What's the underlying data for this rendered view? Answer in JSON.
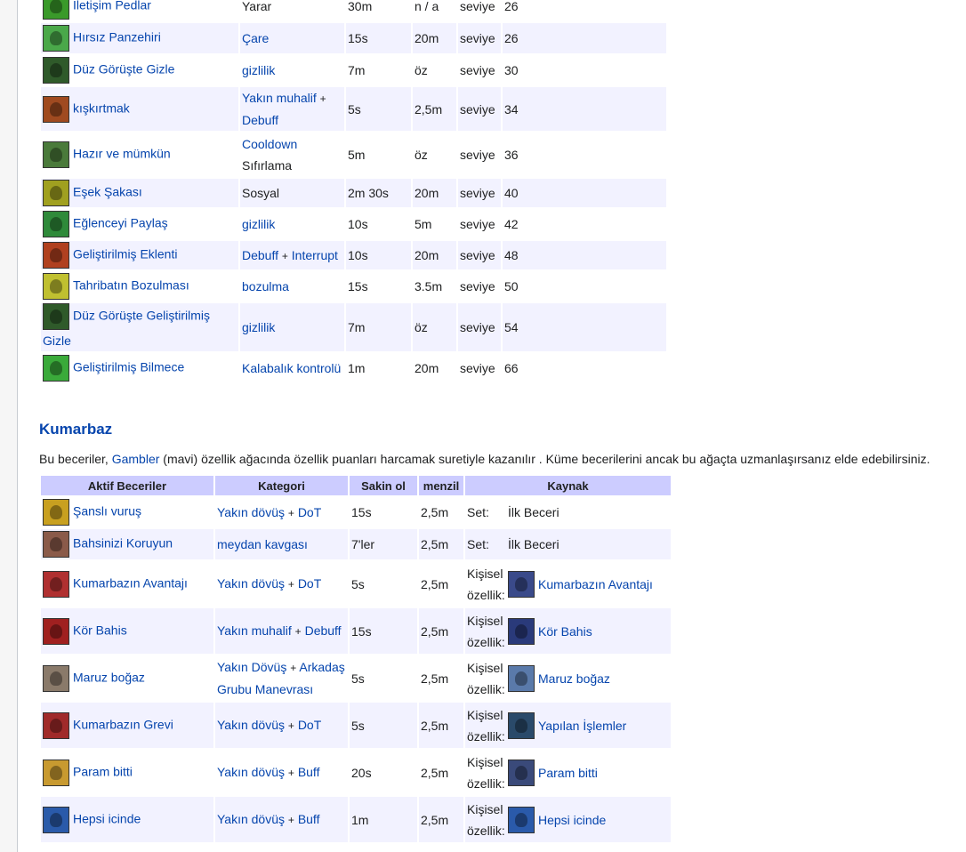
{
  "upper_table": {
    "rows": [
      {
        "icon": "green-hand-icon",
        "icon_color": "#3a9a2a",
        "name": "İletişim Pedlar",
        "cat1": "Yarar",
        "cat1_link": false,
        "plus": "",
        "cat2": "",
        "cat2_link": false,
        "cat_line2": "",
        "cooldown": "30m",
        "range": "n / a",
        "level_label": "seviye",
        "level": "26"
      },
      {
        "icon": "antidote-bottle-icon",
        "icon_color": "#4aa84a",
        "name": "Hırsız Panzehiri",
        "cat1": "Çare",
        "cat1_link": true,
        "plus": "",
        "cat2": "",
        "cat2_link": false,
        "cat_line2": "",
        "cooldown": "15s",
        "range": "20m",
        "level_label": "seviye",
        "level": "26"
      },
      {
        "icon": "hidden-figure-icon",
        "icon_color": "#2f5a2a",
        "name": "Düz Görüşte Gizle",
        "cat1": "gizlilik",
        "cat1_link": true,
        "plus": "",
        "cat2": "",
        "cat2_link": false,
        "cat_line2": "",
        "cooldown": "7m",
        "range": "öz",
        "level_label": "seviye",
        "level": "30"
      },
      {
        "icon": "provoke-face-icon",
        "icon_color": "#a04a20",
        "name": "kışkırtmak",
        "cat1": "Yakın muhalif",
        "cat1_link": true,
        "plus": "+",
        "cat2": "",
        "cat2_link": false,
        "cat_line2": "Debuff",
        "cooldown": "5s",
        "range": "2,5m",
        "level_label": "seviye",
        "level": "34"
      },
      {
        "icon": "ready-figure-icon",
        "icon_color": "#4a7a3a",
        "name": "Hazır ve mümkün",
        "cat1": "Cooldown",
        "cat1_link": true,
        "plus": "",
        "cat2": "",
        "cat2_link": false,
        "cat_line2": "Sıfırlama",
        "cooldown": "5m",
        "range": "öz",
        "level_label": "seviye",
        "level": "36"
      },
      {
        "icon": "joker-face-icon",
        "icon_color": "#a0a020",
        "name": "Eşek Şakası",
        "cat1": "Sosyal",
        "cat1_link": false,
        "plus": "",
        "cat2": "",
        "cat2_link": false,
        "cat_line2": "",
        "cooldown": "2m 30s",
        "range": "20m",
        "level_label": "seviye",
        "level": "40"
      },
      {
        "icon": "share-fun-icon",
        "icon_color": "#2f8a3a",
        "name": "Eğlenceyi Paylaş",
        "cat1": "gizlilik",
        "cat1_link": true,
        "plus": "",
        "cat2": "",
        "cat2_link": false,
        "cat_line2": "",
        "cooldown": "10s",
        "range": "5m",
        "level_label": "seviye",
        "level": "42"
      },
      {
        "icon": "enhanced-face-icon",
        "icon_color": "#b04020",
        "name": "Geliştirilmiş Eklenti",
        "cat1": "Debuff",
        "cat1_link": true,
        "plus": "+",
        "cat2": "Interrupt",
        "cat2_link": true,
        "cat_line2": "",
        "cooldown": "10s",
        "range": "20m",
        "level_label": "seviye",
        "level": "48"
      },
      {
        "icon": "ruin-hand-icon",
        "icon_color": "#c0c030",
        "name": "Tahribatın Bozulması",
        "cat1": "bozulma",
        "cat1_link": true,
        "plus": "",
        "cat2": "",
        "cat2_link": false,
        "cat_line2": "",
        "cooldown": "15s",
        "range": "3.5m",
        "level_label": "seviye",
        "level": "50"
      },
      {
        "icon": "hidden-figure-icon",
        "icon_color": "#2f5a2a",
        "name": "Düz Görüşte Geliştirilmiş Gizle",
        "cat1": "gizlilik",
        "cat1_link": true,
        "plus": "",
        "cat2": "",
        "cat2_link": false,
        "cat_line2": "",
        "cooldown": "7m",
        "range": "öz",
        "level_label": "seviye",
        "level": "54"
      },
      {
        "icon": "question-mark-icon",
        "icon_color": "#3aaa3a",
        "name": "Geliştirilmiş Bilmece",
        "cat1": "Kalabalık kontrolü",
        "cat1_link": true,
        "plus": "",
        "cat2": "",
        "cat2_link": false,
        "cat_line2": "",
        "cooldown": "1m",
        "range": "20m",
        "level_label": "seviye",
        "level": "66"
      }
    ]
  },
  "section": {
    "title": "Kumarbaz",
    "desc_before": "Bu beceriler, ",
    "desc_link": "Gambler",
    "desc_after": " (mavi) özellik ağacında özellik puanları harcamak suretiyle kazanılır . Küme becerilerini ancak bu ağaçta uzmanlaşırsanız elde edebilirsiniz."
  },
  "gambler_table": {
    "headers": {
      "active": "Aktif Beceriler",
      "category": "Kategori",
      "cooldown": "Sakin ol",
      "range": "menzil",
      "source": "Kaynak"
    },
    "rows": [
      {
        "icon": "lucky-dice-icon",
        "icon_color": "#c8a020",
        "name": "Şanslı vuruş",
        "cat1": "Yakın dövüş",
        "plus": "+",
        "cat2": "DoT",
        "cat_line2": "",
        "cooldown": "15s",
        "range": "2,5m",
        "src_label1": "Set:",
        "src_label2": "",
        "src_icon": "",
        "src_color": "",
        "src_text": "İlk Beceri",
        "src_link": false
      },
      {
        "icon": "protect-bet-icon",
        "icon_color": "#8a5a4a",
        "name": "Bahsinizi Koruyun",
        "cat1": "meydan kavgası",
        "plus": "",
        "cat2": "",
        "cat_line2": "",
        "cooldown": "7'ler",
        "range": "2,5m",
        "src_label1": "Set:",
        "src_label2": "",
        "src_icon": "",
        "src_color": "",
        "src_text": "İlk Beceri",
        "src_link": false
      },
      {
        "icon": "gambler-edge-icon",
        "icon_color": "#b03030",
        "name": "Kumarbazın Avantajı",
        "cat1": "Yakın dövüş",
        "plus": "+",
        "cat2": "DoT",
        "cat_line2": "",
        "cooldown": "5s",
        "range": "2,5m",
        "src_label1": "Kişisel",
        "src_label2": "özellik:",
        "src_icon": "gambler-edge-icon",
        "src_color": "#3a4a8a",
        "src_text": "Kumarbazın Avantajı",
        "src_link": true
      },
      {
        "icon": "blind-bet-icon",
        "icon_color": "#a02020",
        "name": "Kör Bahis",
        "cat1": "Yakın muhalif",
        "plus": "+",
        "cat2": "Debuff",
        "cat_line2": "",
        "cooldown": "15s",
        "range": "2,5m",
        "src_label1": "Kişisel",
        "src_label2": "özellik:",
        "src_icon": "blind-bet-icon",
        "src_color": "#2a3a7a",
        "src_text": "Kör Bahis",
        "src_link": true
      },
      {
        "icon": "exposed-throat-icon",
        "icon_color": "#8a7a6a",
        "name": "Maruz boğaz",
        "cat1": "Yakın Dövüş",
        "plus": "+",
        "cat2": "Arkadaş",
        "cat_line2": "Grubu Manevrası",
        "cooldown": "5s",
        "range": "2,5m",
        "src_label1": "Kişisel",
        "src_label2": "özellik:",
        "src_icon": "exposed-throat-icon",
        "src_color": "#5a7aaa",
        "src_text": "Maruz boğaz",
        "src_link": true
      },
      {
        "icon": "gambler-strike-icon",
        "icon_color": "#a02a2a",
        "name": "Kumarbazın Grevi",
        "cat1": "Yakın dövüş",
        "plus": "+",
        "cat2": "DoT",
        "cat_line2": "",
        "cooldown": "5s",
        "range": "2,5m",
        "src_label1": "Kişisel",
        "src_label2": "özellik:",
        "src_icon": "deals-made-icon",
        "src_color": "#2a4a6a",
        "src_text": "Yapılan İşlemler",
        "src_link": true
      },
      {
        "icon": "money-spent-icon",
        "icon_color": "#c89a30",
        "name": "Param bitti",
        "cat1": "Yakın dövüş",
        "plus": "+",
        "cat2": "Buff",
        "cat_line2": "",
        "cooldown": "20s",
        "range": "2,5m",
        "src_label1": "Kişisel",
        "src_label2": "özellik:",
        "src_icon": "money-spent-icon",
        "src_color": "#3a4a7a",
        "src_text": "Param bitti",
        "src_link": true
      },
      {
        "icon": "all-in-icon",
        "icon_color": "#2a5aaa",
        "name": "Hepsi icinde",
        "cat1": "Yakın dövüş",
        "plus": "+",
        "cat2": "Buff",
        "cat_line2": "",
        "cooldown": "1m",
        "range": "2,5m",
        "src_label1": "Kişisel",
        "src_label2": "özellik:",
        "src_icon": "all-in-icon",
        "src_color": "#2a5aaa",
        "src_text": "Hepsi icinde",
        "src_link": true
      }
    ]
  }
}
